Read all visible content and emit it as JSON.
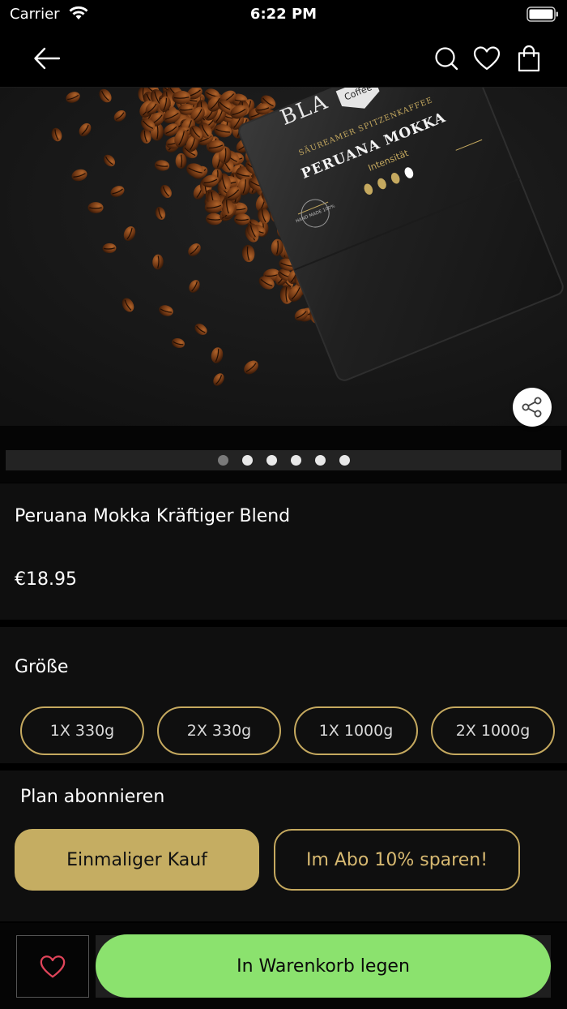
{
  "status": {
    "carrier": "Carrier",
    "time": "6:22 PM"
  },
  "nav": {
    "icons": [
      "back-arrow-icon",
      "search-icon",
      "heart-icon",
      "shopping-bag-icon"
    ]
  },
  "hero": {
    "pack_text": {
      "brand": "BLA",
      "badge": "Coffee",
      "tagline": "SÄUREAMER SPITZENKAFFEE",
      "name": "PERUANA MOKKA",
      "intensity_label": "Intensität",
      "seal": "HAND MADE 100%"
    },
    "pager": {
      "total": 6,
      "active_index": 0
    }
  },
  "product": {
    "title": "Peruana Mokka Kräftiger Blend",
    "price": "€18.95"
  },
  "size": {
    "title": "Größe",
    "options": [
      "1X 330g",
      "2X 330g",
      "1X 1000g",
      "2X 1000g"
    ]
  },
  "plan": {
    "title": "Plan abonnieren",
    "options": [
      "Einmaliger Kauf",
      "Im Abo 10% sparen!"
    ],
    "selected_index": 0
  },
  "bottom": {
    "cart_label": "In Warenkorb legen"
  },
  "colors": {
    "gold": "#c5a95f",
    "gold_fill": "#c5ad62",
    "cart_green": "#8be26e",
    "wish_heart": "#e0445a"
  }
}
